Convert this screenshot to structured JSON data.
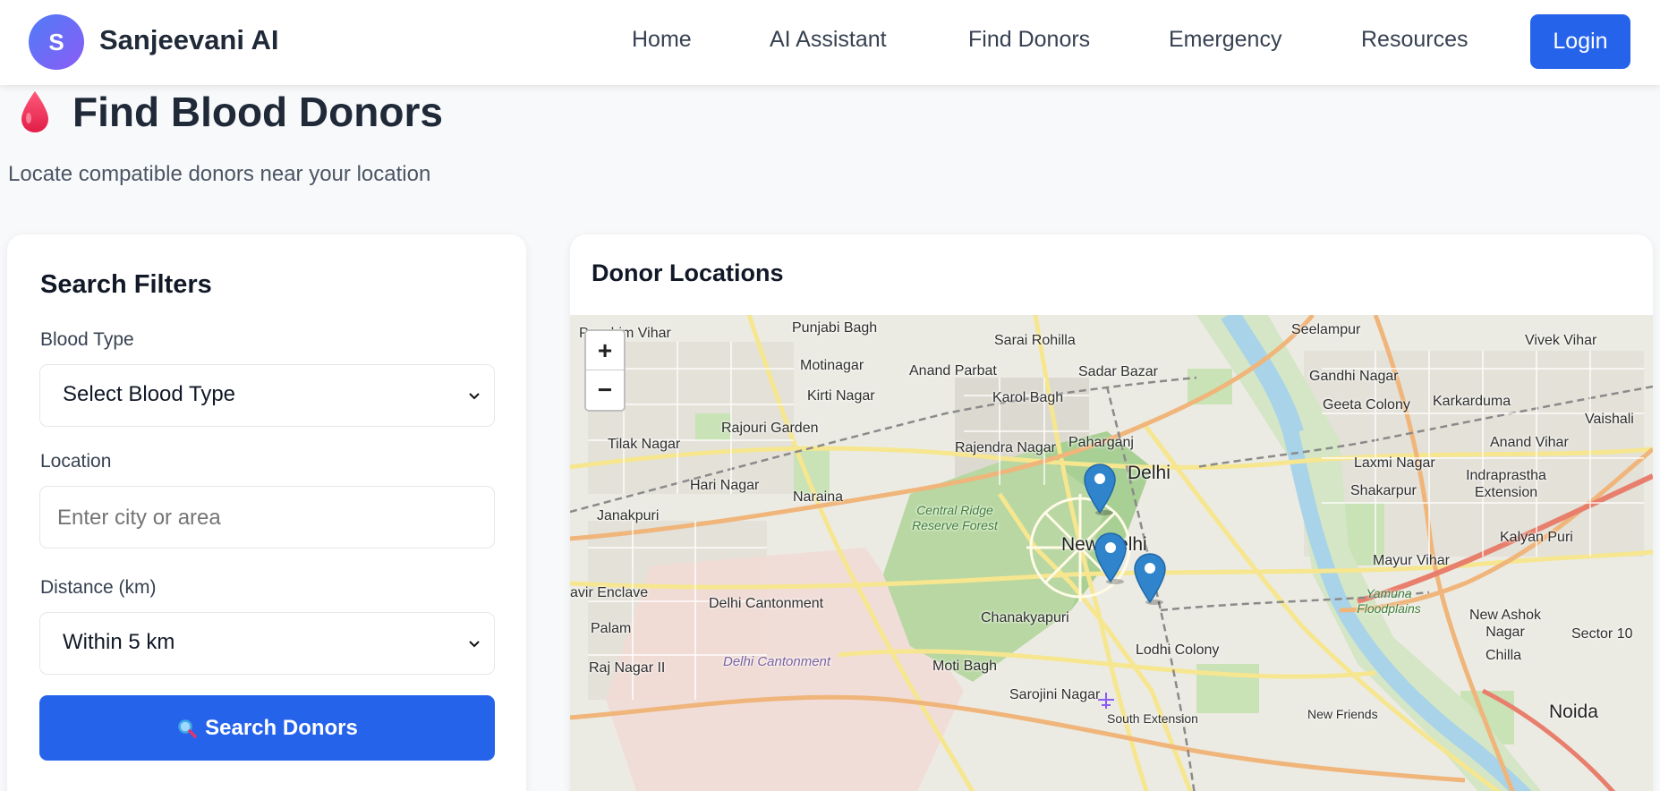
{
  "header": {
    "logo_letter": "S",
    "brand": "Sanjeevani AI",
    "nav": [
      "Home",
      "AI Assistant",
      "Find Donors",
      "Emergency",
      "Resources"
    ],
    "login_label": "Login",
    "accent_color": "#2563eb"
  },
  "page": {
    "title": "Find Blood Donors",
    "subtitle": "Locate compatible donors near your location",
    "title_icon": "blood-drop-icon"
  },
  "filters": {
    "title": "Search Filters",
    "blood_type_label": "Blood Type",
    "blood_type_value": "Select Blood Type",
    "location_label": "Location",
    "location_placeholder": "Enter city or area",
    "distance_label": "Distance (km)",
    "distance_value": "Within 5 km",
    "search_button_label": "Search Donors",
    "search_icon": "magnifier-icon"
  },
  "map": {
    "title": "Donor Locations",
    "zoom_in": "+",
    "zoom_out": "−",
    "marker_count": 3,
    "labels": {
      "paschim_vihar": "Paschim Vihar",
      "punjabi_bagh": "Punjabi Bagh",
      "sarai_rohilla": "Sarai Rohilla",
      "seelampur": "Seelampur",
      "vivek_vihar": "Vivek Vihar",
      "motinagar": "Motinagar",
      "anand_parbat": "Anand Parbat",
      "sadar_bazar": "Sadar Bazar",
      "gandhi_nagar": "Gandhi Nagar",
      "kirti_nagar": "Kirti Nagar",
      "karol_bagh": "Karol Bagh",
      "geeta_colony": "Geeta Colony",
      "karkarduma": "Karkarduma",
      "vaishali": "Vaishali",
      "rajouri_garden": "Rajouri Garden",
      "tilak_nagar": "Tilak Nagar",
      "rajendra_nagar": "Rajendra Nagar",
      "paharganj": "Paharganj",
      "anand_vihar": "Anand Vihar",
      "delhi": "Delhi",
      "laxmi_nagar": "Laxmi Nagar",
      "indraprastha_extension": "Indraprastha Extension",
      "hari_nagar": "Hari Nagar",
      "shakarpur": "Shakarpur",
      "naraina": "Naraina",
      "janakpuri": "Janakpuri",
      "central_ridge": "Central Ridge Reserve Forest",
      "new_delhi": "New Delhi",
      "kalyan_puri": "Kalyan Puri",
      "mayur_vihar": "Mayur Vihar",
      "vikaspuri_enclave": "avir Enclave",
      "delhi_cantonment": "Delhi Cantonment",
      "yamuna_floodplains": "Yamuna Floodplains",
      "chanakyapuri": "Chanakyapuri",
      "new_ashok_nagar": "New Ashok Nagar",
      "palam": "Palam",
      "sector_10": "Sector 10",
      "delhi_cantonment_area": "Delhi Cantonment",
      "lodhi_colony": "Lodhi Colony",
      "chilla": "Chilla",
      "raj_nagar": "Raj Nagar II",
      "moti_bagh": "Moti Bagh",
      "sarojini_nagar": "Sarojini Nagar",
      "noida": "Noida",
      "new_friends": "New Friends",
      "south_extension": "South Extension"
    }
  }
}
